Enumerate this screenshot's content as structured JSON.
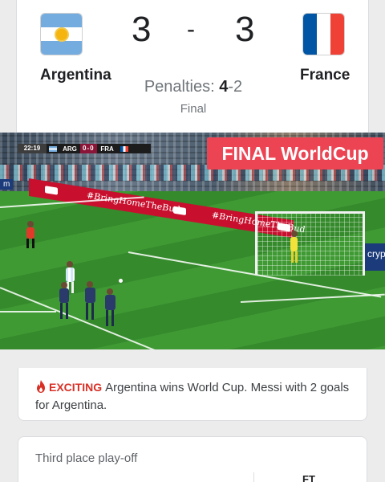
{
  "match": {
    "home_team": "Argentina",
    "away_team": "France",
    "home_score": "3",
    "away_score": "3",
    "score_separator": "-",
    "penalties_label": "Penalties:",
    "penalties_home": "4",
    "penalties_separator": "-",
    "penalties_away": "2",
    "stage": "Final",
    "home_flag_icon": "argentina-flag-icon",
    "away_flag_icon": "france-flag-icon"
  },
  "video": {
    "banner_text": "FINAL WorldCup",
    "scorebug": {
      "clock": "22:19",
      "home": "ARG",
      "home_goals": "0",
      "separator": "-",
      "away_goals": "0",
      "away": "FRA"
    },
    "ad_text": "#BringHomeTheBud",
    "side_ad_text": "cryp",
    "left_ad_text": "m"
  },
  "news": {
    "tag": "EXCITING",
    "icon": "fire-icon",
    "text": "Argentina wins World Cup. Messi with 2 goals for Argentina."
  },
  "third_place": {
    "title": "Third place play-off",
    "status": "FT"
  },
  "colors": {
    "argentina_blue": "#74acdf",
    "france_blue": "#0055a4",
    "france_red": "#ef4135",
    "banner_red": "#ec4453",
    "exciting_red": "#d93025"
  }
}
